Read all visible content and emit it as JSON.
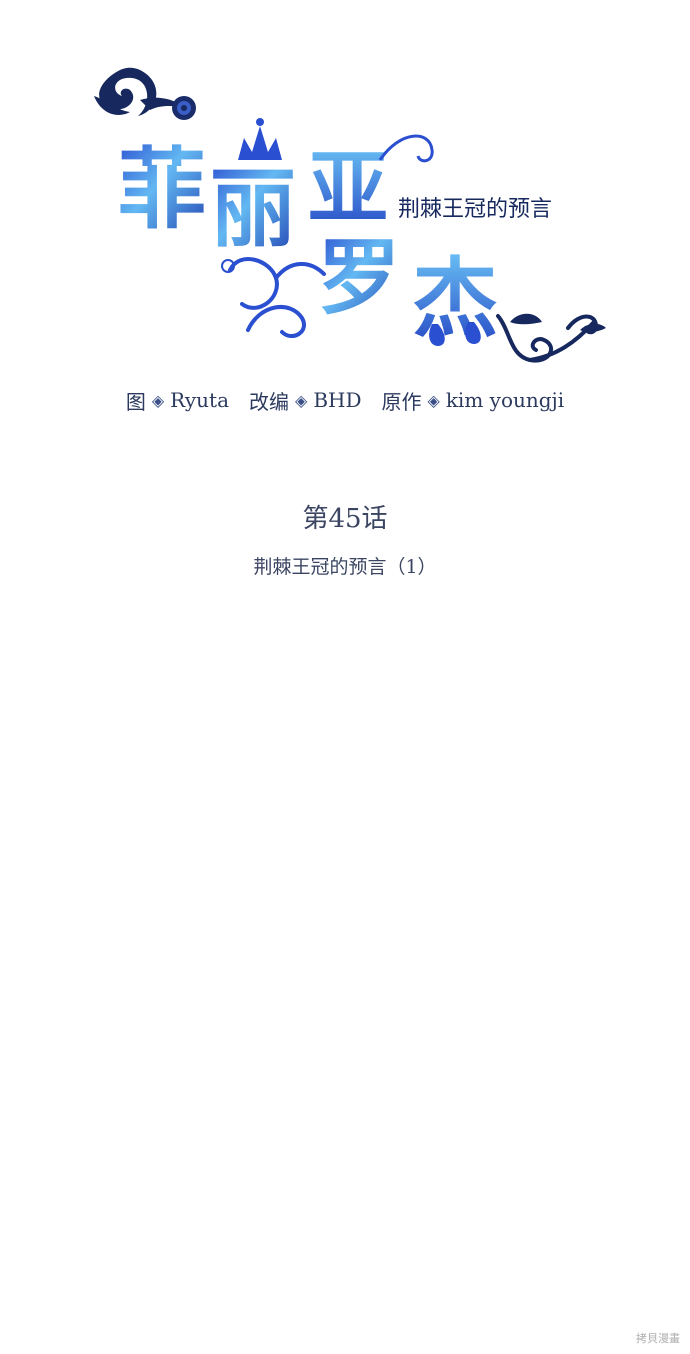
{
  "logo": {
    "title_chars": [
      "菲",
      "丽",
      "亚",
      "罗",
      "杰"
    ],
    "subtitle": "荆棘王冠的预言"
  },
  "credits": {
    "art_label": "图",
    "art_name": "Ryuta",
    "adapt_label": "改编",
    "adapt_name": "BHD",
    "original_label": "原作",
    "original_name": "kim youngji",
    "separator": "◈"
  },
  "chapter": {
    "number": "第45话",
    "title": "荆棘王冠的预言（1）"
  },
  "watermark": "拷貝漫畫",
  "colors": {
    "title_blue_light": "#5ab0f0",
    "title_blue_dark": "#1a3fb8",
    "ornament_navy": "#16285e",
    "text": "#3c4663"
  }
}
